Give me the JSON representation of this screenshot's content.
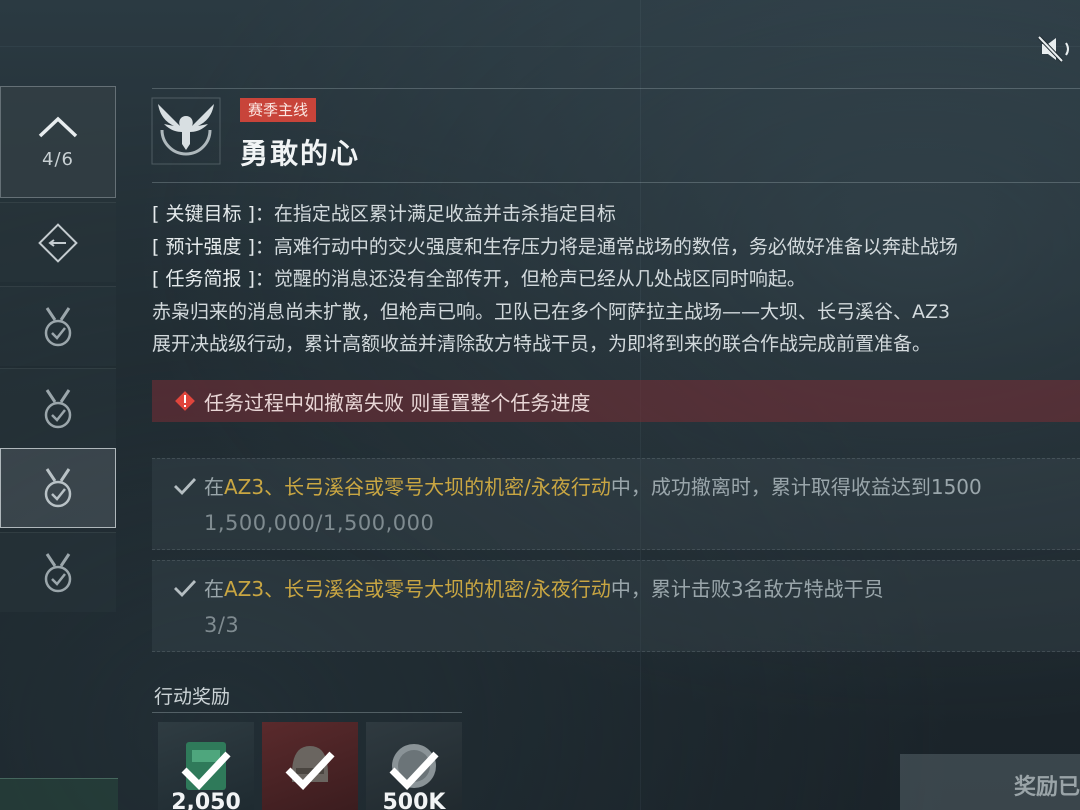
{
  "header": {
    "tag": "赛季主线",
    "title": "勇敢的心"
  },
  "rail": {
    "counter": "4/6",
    "items": [
      {
        "icon": "chevron-up-icon"
      },
      {
        "icon": "operation-diamond-icon"
      },
      {
        "icon": "medal-check-icon"
      },
      {
        "icon": "medal-check-icon"
      },
      {
        "icon": "medal-check-icon",
        "active": true
      },
      {
        "icon": "medal-check-icon"
      }
    ]
  },
  "brief": {
    "key_objective_label": "[ 关键目标 ]",
    "key_objective": "在指定战区累计满足收益并击杀指定目标",
    "intensity_label": "[ 预计强度 ]",
    "intensity": "高难行动中的交火强度和生存压力将是通常战场的数倍，务必做好准备以奔赴战场",
    "summary_label": "[ 任务简报 ]",
    "summary": "觉醒的消息还没有全部传开，但枪声已经从几处战区同时响起。",
    "story_line1": "赤枭归来的消息尚未扩散，但枪声已响。卫队已在多个阿萨拉主战场——大坝、长弓溪谷、AZ3",
    "story_line2": "展开决战级行动，累计高额收益并清除敌方特战干员，为即将到来的联合作战完成前置准备。"
  },
  "warning": {
    "text": "任务过程中如撤离失败 则重置整个任务进度"
  },
  "objectives": [
    {
      "prefix": "在",
      "highlight": "AZ3、长弓溪谷或零号大坝的机密/永夜行动",
      "suffix": "中，成功撤离时，累计取得收益达到1500",
      "progress": "1,500,000/1,500,000"
    },
    {
      "prefix": "在",
      "highlight": "AZ3、长弓溪谷或零号大坝的机密/永夜行动",
      "suffix": "中，累计击败3名敌方特战干员",
      "progress": "3/3"
    }
  ],
  "rewards": {
    "title": "行动奖励",
    "items": [
      {
        "amount": "2,050",
        "claimed": true
      },
      {
        "amount": "",
        "claimed": true
      },
      {
        "amount": "500K",
        "claimed": true
      }
    ],
    "claim_button": "奖励已"
  },
  "colors": {
    "tag_red": "#c8443a",
    "highlight_gold": "#c9a642",
    "warning_bg": "#782d34"
  }
}
